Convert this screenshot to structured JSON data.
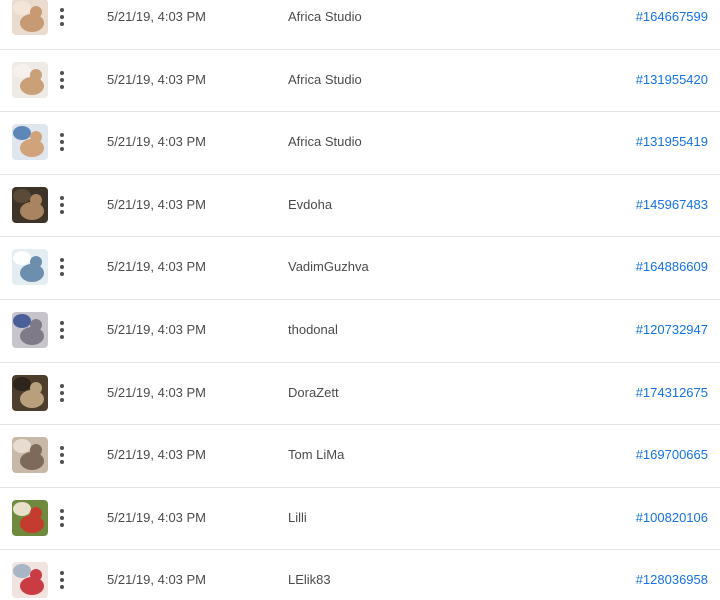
{
  "rows": [
    {
      "date": "5/21/19, 4:03 PM",
      "author": "Africa Studio",
      "id": "#164667599",
      "thumb": {
        "bg": "#e9dccf",
        "fg": "#c79a73",
        "accent": "#f3e6d8"
      }
    },
    {
      "date": "5/21/19, 4:03 PM",
      "author": "Africa Studio",
      "id": "#131955420",
      "thumb": {
        "bg": "#eeeae6",
        "fg": "#c9a078",
        "accent": "#f6f1ec"
      }
    },
    {
      "date": "5/21/19, 4:03 PM",
      "author": "Africa Studio",
      "id": "#131955419",
      "thumb": {
        "bg": "#dfe6ee",
        "fg": "#d1a37a",
        "accent": "#5f86b8"
      }
    },
    {
      "date": "5/21/19, 4:03 PM",
      "author": "Evdoha",
      "id": "#145967483",
      "thumb": {
        "bg": "#3e3329",
        "fg": "#a98460",
        "accent": "#5c4a38"
      }
    },
    {
      "date": "5/21/19, 4:03 PM",
      "author": "VadimGuzhva",
      "id": "#164886609",
      "thumb": {
        "bg": "#e4edf2",
        "fg": "#6d8fae",
        "accent": "#ffffff"
      }
    },
    {
      "date": "5/21/19, 4:03 PM",
      "author": "thodonal",
      "id": "#120732947",
      "thumb": {
        "bg": "#c7c4cc",
        "fg": "#7e7a86",
        "accent": "#4a5f9a"
      }
    },
    {
      "date": "5/21/19, 4:03 PM",
      "author": "DoraZett",
      "id": "#174312675",
      "thumb": {
        "bg": "#4c3d2c",
        "fg": "#b8a07c",
        "accent": "#2d241b"
      }
    },
    {
      "date": "5/21/19, 4:03 PM",
      "author": "Tom LiMa",
      "id": "#169700665",
      "thumb": {
        "bg": "#c8b8a8",
        "fg": "#7d6a58",
        "accent": "#e7dccf"
      }
    },
    {
      "date": "5/21/19, 4:03 PM",
      "author": "Lilli",
      "id": "#100820106",
      "thumb": {
        "bg": "#6f8a3e",
        "fg": "#c43c2e",
        "accent": "#e8e0c8"
      }
    },
    {
      "date": "5/21/19, 4:03 PM",
      "author": "LElik83",
      "id": "#128036958",
      "thumb": {
        "bg": "#f1e3df",
        "fg": "#c93c44",
        "accent": "#a7b5c6"
      }
    }
  ]
}
